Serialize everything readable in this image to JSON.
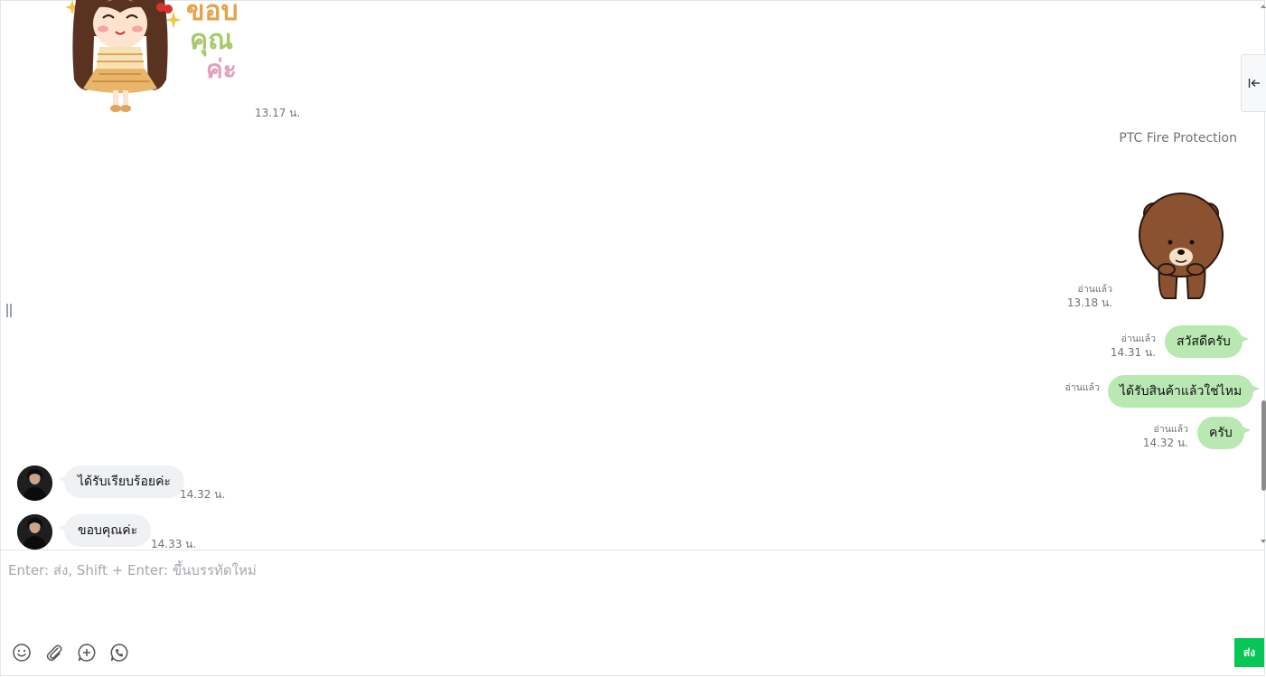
{
  "header": {
    "sender_name": "PTC Fire Protection"
  },
  "messages": [
    {
      "type": "sticker",
      "direction": "in",
      "sticker": "girl-thank-you-sticker",
      "sticker_text": "ขอบคุณค่ะ",
      "time": "13.17 น."
    },
    {
      "type": "sticker",
      "direction": "out",
      "sticker": "brown-bear-sticker",
      "read": "อ่านแล้ว",
      "time": "13.18 น."
    },
    {
      "type": "text",
      "direction": "out",
      "text": "สวัสดีครับ",
      "read": "อ่านแล้ว",
      "time": "14.31 น."
    },
    {
      "type": "text",
      "direction": "out",
      "text": "ได้รับสินค้าแล้วใช่ไหม",
      "read": "อ่านแล้ว",
      "time": ""
    },
    {
      "type": "text",
      "direction": "out",
      "text": "ครับ",
      "read": "อ่านแล้ว",
      "time": "14.32 น."
    },
    {
      "type": "text",
      "direction": "in",
      "text": "ได้รับเรียบร้อยค่ะ",
      "time": "14.32 น."
    },
    {
      "type": "text",
      "direction": "in",
      "text": "ขอบคุณค่ะ",
      "time": "14.33 น."
    }
  ],
  "composer": {
    "placeholder": "Enter: ส่ง, Shift + Enter: ขึ้นบรรทัดใหม่",
    "send_label": "ส่ง",
    "tools": [
      "emoji-icon",
      "attachment-icon",
      "add-circle-icon",
      "voice-call-icon"
    ]
  },
  "colors": {
    "outgoing_bubble": "#b9e8b3",
    "incoming_bubble": "#f0f1f3",
    "send_button": "#06c755"
  }
}
